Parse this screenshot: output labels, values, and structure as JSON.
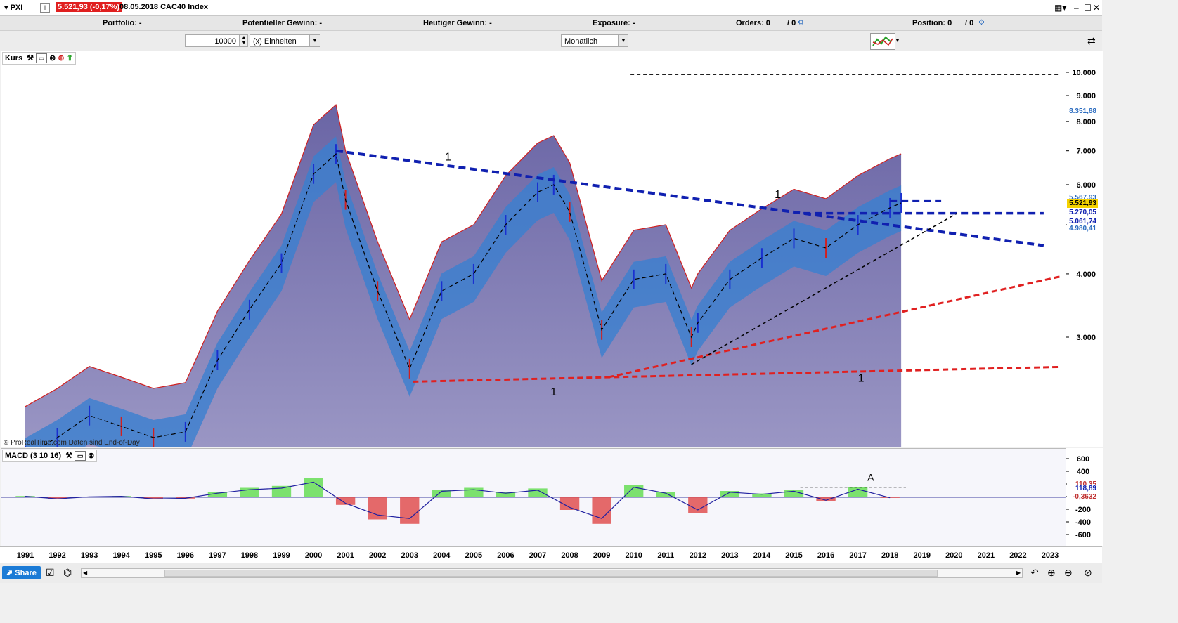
{
  "header": {
    "symbol": "PXI",
    "info_icon": "info-icon",
    "price_change": "5.521,93 (-0,17%)",
    "date_index": "08.05.2018 CAC40 Index",
    "price_change_color": "#e02020"
  },
  "stats": {
    "portfolio": "Portfolio: -",
    "potential": "Potentieller Gewinn: -",
    "today": "Heutiger Gewinn: -",
    "exposure": "Exposure: -",
    "orders_label": "Orders: 0",
    "orders_sep": "/ 0",
    "position_label": "Position: 0",
    "position_sep": "/ 0"
  },
  "controls": {
    "quantity": "10000",
    "units": "(x) Einheiten",
    "period": "Monatlich"
  },
  "panels": {
    "price_panel": "Kurs",
    "macd_panel": "MACD (3 10 16)",
    "watermark": "© ProRealTime.com Daten sind End-of-Day"
  },
  "price_labels": {
    "current": "5.521,93",
    "upper_band": "8.351,88",
    "level_a": "5.567,93",
    "level_b": "5.270,05",
    "level_c": "5.061,74",
    "level_d": "4.980,41"
  },
  "macd_labels": {
    "value_a": "118,89",
    "value_b": "-0,3632",
    "value_top": "110,35"
  },
  "trend_labels": [
    "1",
    "1",
    "1",
    "1"
  ],
  "pattern_label": "A",
  "share_button": "Share",
  "colors": {
    "upper_area": "#6a65a5",
    "lower_area": "#9a96c4",
    "cloud": "#3a7fd0",
    "dashed_blue": "#1020b0",
    "dashed_red": "#e02020",
    "macd_pos": "#66dd55",
    "macd_neg": "#e05050"
  },
  "chart_data": [
    {
      "type": "line",
      "title": "Kurs",
      "x": [
        1991,
        1992,
        1993,
        1994,
        1995,
        1996,
        1997,
        1998,
        1999,
        2000,
        2001,
        2002,
        2003,
        2004,
        2005,
        2006,
        2007,
        2008,
        2009,
        2010,
        2011,
        2012,
        2013,
        2014,
        2015,
        2016,
        2017,
        2018,
        2019,
        2020,
        2021,
        2022,
        2023
      ],
      "x_labels": [
        "1991",
        "1992",
        "1993",
        "1994",
        "1995",
        "1996",
        "1997",
        "1998",
        "1999",
        "2000",
        "2001",
        "2002",
        "2003",
        "2004",
        "2005",
        "2006",
        "2007",
        "2008",
        "2009",
        "2010",
        "2011",
        "2012",
        "2013",
        "2014",
        "2015",
        "2016",
        "2017",
        "2018",
        "2019",
        "2020",
        "2021",
        "2022",
        "2023"
      ],
      "y_ticks": [
        3000,
        4000,
        5000,
        6000,
        7000,
        8000,
        9000,
        10000
      ],
      "y_tick_labels": [
        "3.000",
        "4.000",
        "5.000",
        "6.000",
        "7.000",
        "8.000",
        "9.000",
        "10.000"
      ],
      "y_scale": "log",
      "grid": false,
      "series": [
        {
          "name": "PXI",
          "x": [
            1991,
            1992,
            1993,
            1994,
            1995,
            1996,
            1997,
            1998,
            1999,
            2000,
            2000.7,
            2001,
            2002,
            2003,
            2004,
            2005,
            2006,
            2007,
            2007.5,
            2008,
            2009,
            2010,
            2011,
            2011.8,
            2012,
            2013,
            2014,
            2015,
            2016,
            2017,
            2018,
            2018.35
          ],
          "values": [
            1750,
            1900,
            2100,
            2000,
            1900,
            1950,
            2700,
            3400,
            4200,
            6300,
            6900,
            5600,
            3700,
            2600,
            3700,
            4000,
            5000,
            5800,
            6000,
            5300,
            3100,
            3900,
            4000,
            3000,
            3200,
            3900,
            4300,
            4700,
            4500,
            5000,
            5400,
            5521.93
          ]
        }
      ],
      "annotations": [
        "1",
        "1",
        "1",
        "1"
      ]
    },
    {
      "type": "bar",
      "title": "MACD (3 10 16)",
      "y_ticks": [
        -600,
        -400,
        -200,
        0,
        200,
        400,
        600
      ],
      "y_tick_labels": [
        "-600",
        "-400",
        "-200",
        "0",
        "200",
        "400",
        "600"
      ],
      "x": [
        1991,
        1992,
        1993,
        1994,
        1995,
        1996,
        1997,
        1998,
        1999,
        2000,
        2001,
        2002,
        2003,
        2004,
        2005,
        2006,
        2007,
        2008,
        2009,
        2010,
        2011,
        2012,
        2013,
        2014,
        2015,
        2016,
        2017,
        2018
      ],
      "values": [
        20,
        -30,
        10,
        20,
        -30,
        -20,
        80,
        150,
        180,
        300,
        -120,
        -350,
        -420,
        120,
        150,
        80,
        140,
        -200,
        -420,
        200,
        80,
        -250,
        100,
        60,
        120,
        -60,
        160,
        -10
      ],
      "grid": false
    }
  ]
}
